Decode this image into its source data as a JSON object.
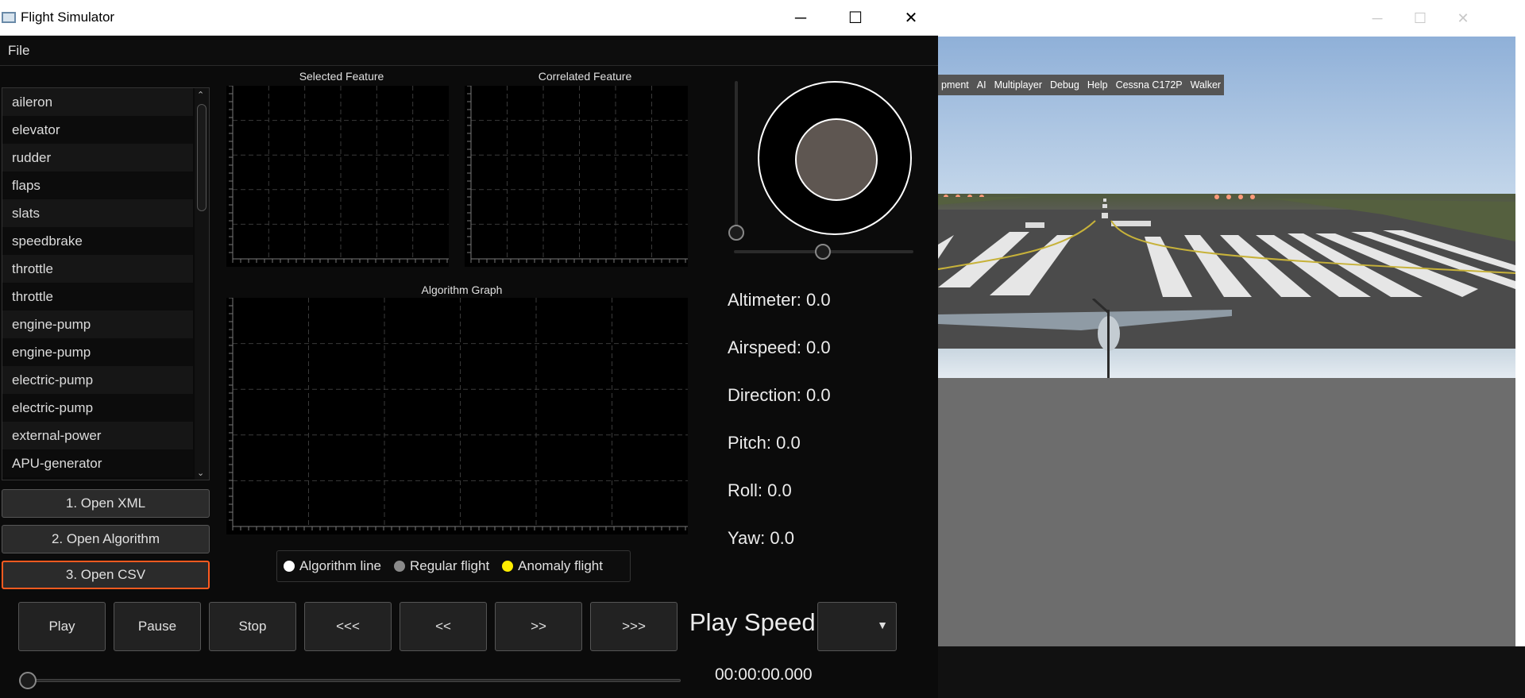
{
  "app": {
    "title": "Flight Simulator",
    "window_controls": {
      "minimize": "─",
      "maximize": "☐",
      "close": "✕"
    },
    "menu": {
      "file": "File"
    }
  },
  "feature_list": {
    "items": [
      "aileron",
      "elevator",
      "rudder",
      "flaps",
      "slats",
      "speedbrake",
      "throttle",
      "throttle",
      "engine-pump",
      "engine-pump",
      "electric-pump",
      "electric-pump",
      "external-power",
      "APU-generator"
    ],
    "scroll_up": "⌃",
    "scroll_down": "⌄"
  },
  "side_buttons": {
    "open_xml": "1. Open XML",
    "open_algorithm": "2. Open Algorithm",
    "open_csv": "3. Open CSV"
  },
  "graphs": {
    "selected_feature_title": "Selected Feature",
    "correlated_feature_title": "Correlated Feature",
    "algorithm_graph_title": "Algorithm Graph"
  },
  "legend": {
    "algorithm_line": "Algorithm line",
    "regular_flight": "Regular flight",
    "anomaly_flight": "Anomaly flight",
    "colors": {
      "algorithm_line": "#ffffff",
      "regular_flight": "#8a8a8a",
      "anomaly_flight": "#ffee00"
    }
  },
  "telemetry": {
    "altimeter": "Altimeter: 0.0",
    "airspeed": "Airspeed: 0.0",
    "direction": "Direction: 0.0",
    "pitch": "Pitch: 0.0",
    "roll": "Roll: 0.0",
    "yaw": "Yaw: 0.0"
  },
  "controls": {
    "play": "Play",
    "pause": "Pause",
    "stop": "Stop",
    "rewind_fast": "<<<",
    "rewind": "<<",
    "forward": ">>",
    "forward_fast": ">>>",
    "play_speed_label": "Play Speed",
    "speed_selected": "",
    "speed_arrow": "▼",
    "time": "00:00:00.000"
  },
  "flightgear": {
    "window_controls": {
      "minimize": "─",
      "maximize": "☐",
      "close": "✕"
    },
    "menu": [
      "pment",
      "AI",
      "Multiplayer",
      "Debug",
      "Help",
      "Cessna C172P",
      "Walker"
    ]
  },
  "theme": {
    "accent": "#ff5a1f",
    "background": "#0b0b0b"
  }
}
